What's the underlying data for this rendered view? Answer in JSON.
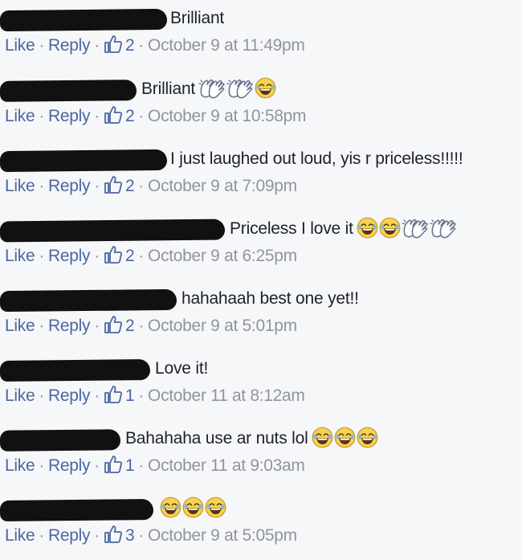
{
  "comments": [
    {
      "text": "Brilliant",
      "emojis": [],
      "like_label": "Like",
      "reply_label": "Reply",
      "likes": "2",
      "time": "October 9 at 11:49pm"
    },
    {
      "text": "Brilliant",
      "emojis": [
        "clap",
        "clap",
        "laugh"
      ],
      "like_label": "Like",
      "reply_label": "Reply",
      "likes": "2",
      "time": "October 9 at 10:58pm"
    },
    {
      "text": "I just laughed out loud, yis r priceless!!!!!",
      "emojis": [],
      "like_label": "Like",
      "reply_label": "Reply",
      "likes": "2",
      "time": "October 9 at 7:09pm"
    },
    {
      "text": "Priceless I love it",
      "emojis": [
        "laugh",
        "laugh",
        "clap",
        "clap"
      ],
      "like_label": "Like",
      "reply_label": "Reply",
      "likes": "2",
      "time": "October 9 at 6:25pm"
    },
    {
      "text": "hahahaah best one yet!!",
      "emojis": [],
      "like_label": "Like",
      "reply_label": "Reply",
      "likes": "2",
      "time": "October 9 at 5:01pm"
    },
    {
      "text": "Love it!",
      "emojis": [],
      "like_label": "Like",
      "reply_label": "Reply",
      "likes": "1",
      "time": "October 11 at 8:12am"
    },
    {
      "text": "Bahahaha use ar nuts lol",
      "emojis": [
        "laugh",
        "laugh",
        "laugh"
      ],
      "like_label": "Like",
      "reply_label": "Reply",
      "likes": "1",
      "time": "October 11 at 9:03am"
    },
    {
      "text": "",
      "emojis": [
        "laugh",
        "laugh",
        "laugh"
      ],
      "like_label": "Like",
      "reply_label": "Reply",
      "likes": "3",
      "time": "October 9 at 5:05pm"
    }
  ],
  "colors": {
    "link": "#4b67a1",
    "meta": "#90949c",
    "text": "#1d2129",
    "background": "#f6f7f9",
    "redaction": "#111111"
  },
  "icons": {
    "like": "thumbs-up-icon",
    "laugh": "laughing-emoji-icon",
    "clap": "clapping-hands-emoji-icon"
  }
}
